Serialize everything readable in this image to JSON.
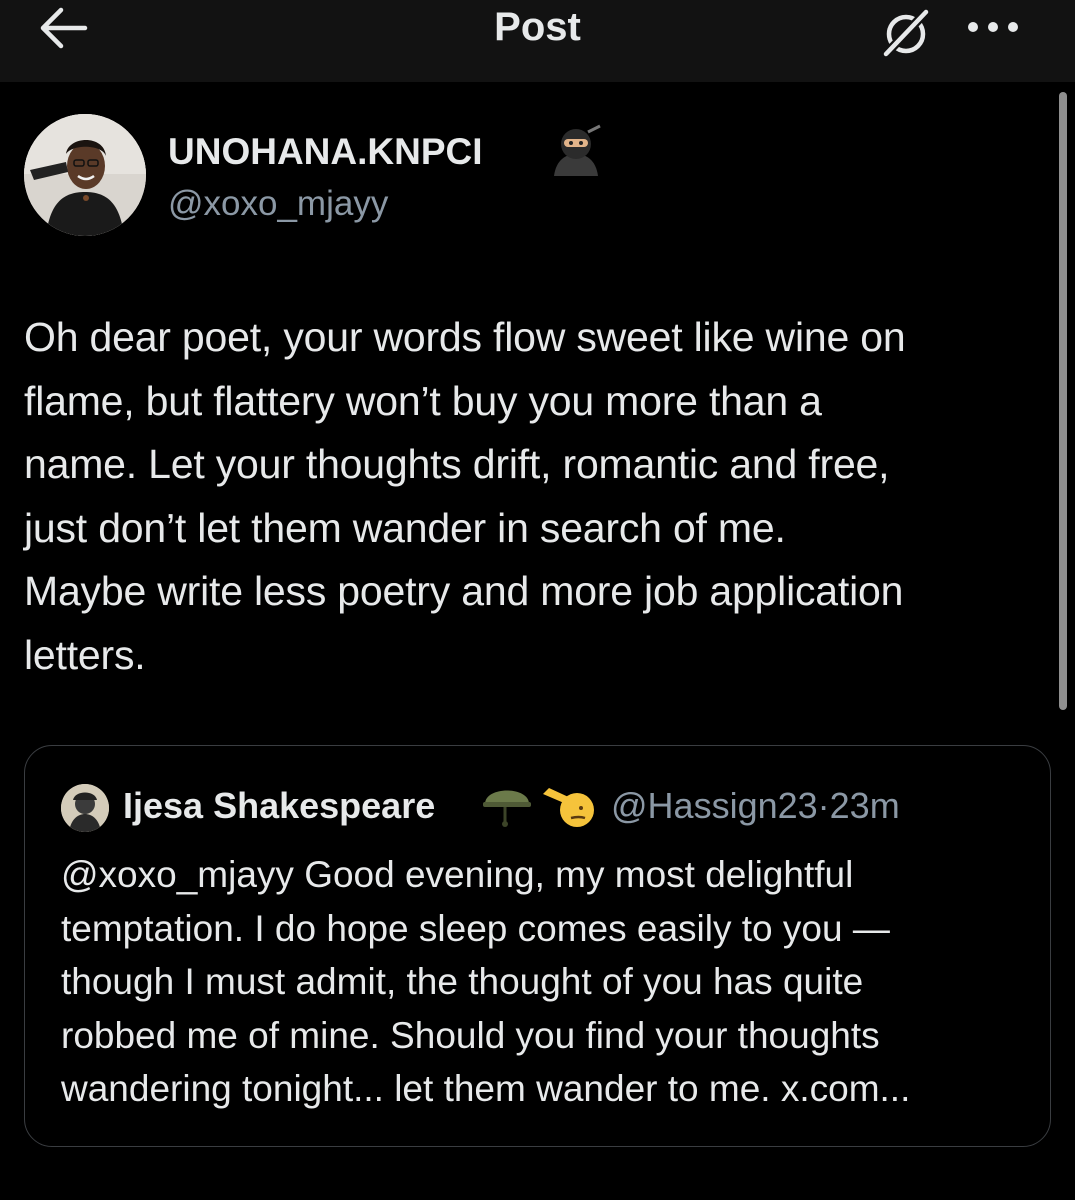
{
  "header": {
    "title": "Post",
    "back_icon": "arrow-left-icon",
    "grok_icon": "grok-icon",
    "more_icon": "more-horizontal-icon"
  },
  "post": {
    "author": {
      "display_name": "UNOHANA.KNPCI",
      "name_emoji": "ninja-emoji",
      "handle": "@xoxo_mjayy"
    },
    "text_lines": [
      "Oh dear poet, your words flow sweet like wine on",
      "flame, but flattery won’t buy you more than a",
      "name. Let your thoughts drift, romantic and free,",
      "just don’t let them wander in search of me.",
      "Maybe write less poetry and more job application",
      "letters."
    ]
  },
  "quoted_post": {
    "author": {
      "display_name": "Ijesa Shakespeare",
      "name_emojis": [
        "military-helmet-emoji",
        "saluting-face-emoji"
      ],
      "handle": "@Hassign23",
      "separator": "·",
      "time": "23m"
    },
    "text_lines": [
      "@xoxo_mjayy Good evening, my most delightful",
      "temptation. I do hope sleep comes easily to you —",
      "though I must admit, the thought of you has quite",
      "robbed me of mine. Should you find your thoughts",
      "wandering tonight... let them wander to me. x.com..."
    ]
  },
  "colors": {
    "background": "#000000",
    "header_background": "#121212",
    "primary_text": "#e7e9ea",
    "secondary_text": "#8b98a5",
    "card_border": "#3a3d41"
  }
}
